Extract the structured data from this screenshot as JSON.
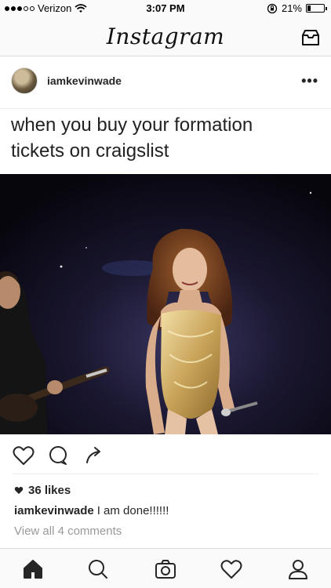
{
  "status_bar": {
    "carrier": "Verizon",
    "time": "3:07 PM",
    "battery_percent": "21%",
    "battery_level": 0.21,
    "signal_bars_filled": 3,
    "signal_bars_total": 5,
    "icons": [
      "wifi-icon",
      "rotation-lock-icon",
      "battery-icon"
    ]
  },
  "nav_bar": {
    "title": "Instagram",
    "right_icon": "inbox-icon"
  },
  "post": {
    "username": "iamkevinwade",
    "more_icon": "more-dots-icon",
    "text_card_lines": [
      "when you buy your formation",
      "tickets on craigslist"
    ],
    "photo_description_icon": "concert-photo",
    "action_icons": [
      "heart-icon",
      "comment-icon",
      "share-icon"
    ],
    "likes": "36 likes",
    "comment_user": "iamkevinwade",
    "comment_text": "I am done!!!!!!",
    "view_comments": "View all 4 comments"
  },
  "tab_bar": {
    "tabs": [
      "home-icon",
      "search-icon",
      "camera-icon",
      "activity-heart-icon",
      "profile-icon"
    ],
    "active_tab": "home-icon"
  },
  "colors": {
    "bar_background": "#fafafa",
    "border": "#dbdbdb",
    "muted_text": "#999999",
    "primary_text": "#262626"
  }
}
